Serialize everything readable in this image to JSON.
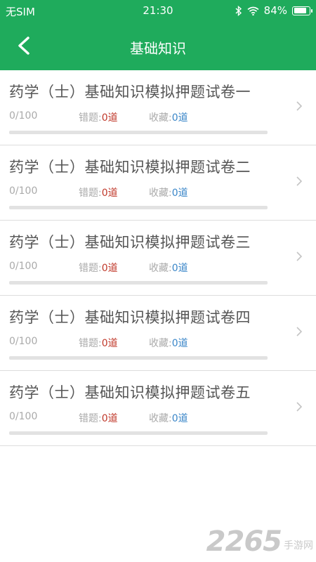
{
  "status_bar": {
    "carrier": "无SIM",
    "time": "21:30",
    "battery": "84%",
    "battery_level": 0.84,
    "icons": [
      "bluetooth-icon",
      "wifi-icon",
      "battery-icon"
    ]
  },
  "header": {
    "title": "基础知识",
    "back_icon": "chevron-left-icon"
  },
  "colors": {
    "brand_green": "#1fab5c",
    "wrong_red": "#c0392b",
    "fav_blue": "#3a86c8"
  },
  "exams": [
    {
      "title": "药学（士）基础知识模拟押题试卷一",
      "progress": "0/100",
      "progress_fraction": 0,
      "wrong_label": "错题:",
      "wrong_value": "0道",
      "fav_label": "收藏:",
      "fav_value": "0道"
    },
    {
      "title": "药学（士）基础知识模拟押题试卷二",
      "progress": "0/100",
      "progress_fraction": 0,
      "wrong_label": "错题:",
      "wrong_value": "0道",
      "fav_label": "收藏:",
      "fav_value": "0道"
    },
    {
      "title": "药学（士）基础知识模拟押题试卷三",
      "progress": "0/100",
      "progress_fraction": 0,
      "wrong_label": "错题:",
      "wrong_value": "0道",
      "fav_label": "收藏:",
      "fav_value": "0道"
    },
    {
      "title": "药学（士）基础知识模拟押题试卷四",
      "progress": "0/100",
      "progress_fraction": 0,
      "wrong_label": "错题:",
      "wrong_value": "0道",
      "fav_label": "收藏:",
      "fav_value": "0道"
    },
    {
      "title": "药学（士）基础知识模拟押题试卷五",
      "progress": "0/100",
      "progress_fraction": 0,
      "wrong_label": "错题:",
      "wrong_value": "0道",
      "fav_label": "收藏:",
      "fav_value": "0道"
    }
  ],
  "watermark": {
    "number": "2265",
    "text": "手游网"
  }
}
